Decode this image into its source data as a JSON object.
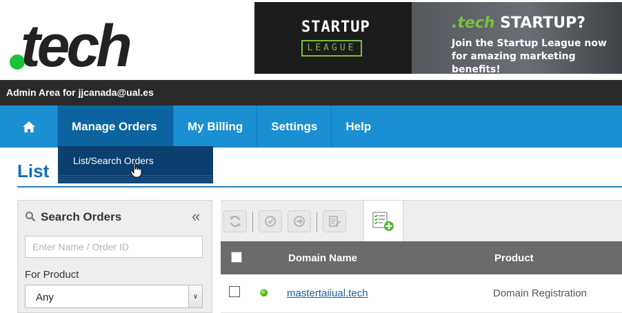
{
  "brand": {
    "logo_text": "tech",
    "logo_dot_color": "#19c23a"
  },
  "banner": {
    "league_top": "STARTUP",
    "league_bottom": "LEAGUE",
    "headline_prefix": ".tech",
    "headline_suffix": "STARTUP?",
    "subtext": "Join the Startup League now for amazing marketing benefits!"
  },
  "admin_bar": {
    "text": "Admin Area for jjcanada@ual.es"
  },
  "nav": {
    "home_icon": "home-icon",
    "items": [
      {
        "label": "Manage Orders",
        "active": true
      },
      {
        "label": "My Billing"
      },
      {
        "label": "Settings"
      },
      {
        "label": "Help"
      }
    ],
    "dropdown": {
      "items": [
        {
          "label": "List/Search Orders"
        }
      ]
    }
  },
  "page": {
    "title": "List"
  },
  "search": {
    "title": "Search Orders",
    "collapse_glyph": "«",
    "name_input": {
      "placeholder": "Enter Name / Order ID",
      "value": ""
    },
    "product_label": "For Product",
    "product_select": {
      "value": "Any"
    }
  },
  "toolbar": {
    "buttons": [
      "refresh-icon",
      "renew-icon",
      "transfer-icon",
      "edit-list-icon"
    ],
    "add_icon": "add-list-icon"
  },
  "table": {
    "columns": [
      "Domain Name",
      "Product"
    ],
    "rows": [
      {
        "status": "active",
        "domain": "mastertaiiual.tech",
        "product": "Domain Registration"
      }
    ]
  },
  "colors": {
    "nav_bg": "#1a8fd1",
    "nav_active": "#0b64a0",
    "title": "#1170b5",
    "table_header": "#6b6b6b"
  }
}
